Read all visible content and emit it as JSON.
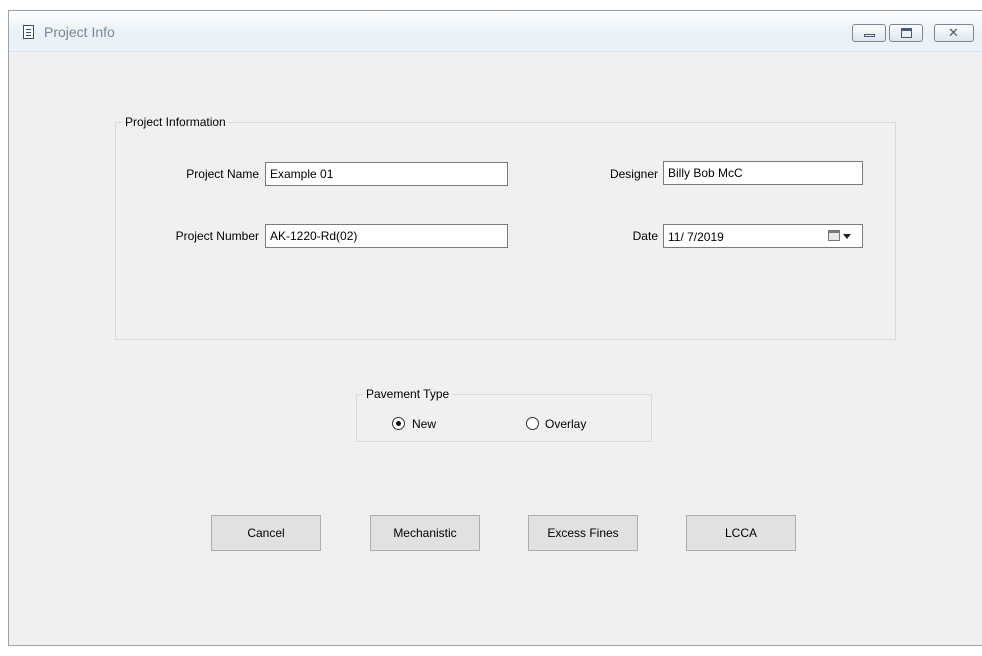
{
  "window": {
    "title": "Project Info"
  },
  "project_info": {
    "legend": "Project Information",
    "project_name_label": "Project Name",
    "project_name_value": "Example 01",
    "project_number_label": "Project Number",
    "project_number_value": "AK-1220-Rd(02)",
    "designer_label": "Designer",
    "designer_value": "Billy Bob McC",
    "date_label": "Date",
    "date_value": "11/ 7/2019"
  },
  "pavement_type": {
    "legend": "Pavement Type",
    "options": [
      {
        "label": "New",
        "selected": true
      },
      {
        "label": "Overlay",
        "selected": false
      }
    ]
  },
  "buttons": {
    "cancel": "Cancel",
    "mechanistic": "Mechanistic",
    "excess_fines": "Excess Fines",
    "lcca": "LCCA"
  }
}
